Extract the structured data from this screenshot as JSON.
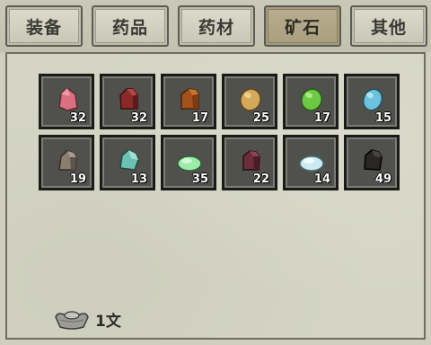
{
  "tabs": [
    {
      "label": "装备",
      "active": false
    },
    {
      "label": "药品",
      "active": false
    },
    {
      "label": "药材",
      "active": false
    },
    {
      "label": "矿石",
      "active": true
    },
    {
      "label": "其他",
      "active": false
    }
  ],
  "inventory": {
    "items": [
      {
        "name": "pink-ore",
        "icon": "ore-shard-icon",
        "color": "#d96f80",
        "count": "32"
      },
      {
        "name": "dark-red-ore",
        "icon": "ore-chunk-icon",
        "color": "#8a2a28",
        "count": "32"
      },
      {
        "name": "brown-ore",
        "icon": "ore-chunk-icon",
        "color": "#a2521a",
        "count": "17"
      },
      {
        "name": "gold-ore",
        "icon": "ore-egg-icon",
        "color": "#d6a85a",
        "count": "25"
      },
      {
        "name": "green-ore",
        "icon": "ore-egg-icon",
        "color": "#6cc944",
        "count": "17"
      },
      {
        "name": "cyan-ore",
        "icon": "ore-egg-icon",
        "color": "#6cc1dc",
        "count": "15"
      },
      {
        "name": "grey-ore",
        "icon": "ore-chunk-icon",
        "color": "#8a7e72",
        "count": "19"
      },
      {
        "name": "teal-ore",
        "icon": "ore-chunk-icon",
        "color": "#6cc2b0",
        "count": "13"
      },
      {
        "name": "light-green-ore",
        "icon": "ore-flat-icon",
        "color": "#9eeaa8",
        "count": "35"
      },
      {
        "name": "maroon-ore",
        "icon": "ore-chunk-icon",
        "color": "#6c2e3c",
        "count": "22"
      },
      {
        "name": "pale-blue-ore",
        "icon": "ore-flat-icon",
        "color": "#c9ecf2",
        "count": "14"
      },
      {
        "name": "black-ore",
        "icon": "ore-chunk-icon",
        "color": "#2a2626",
        "count": "49"
      }
    ]
  },
  "money": {
    "icon": "silver-ingot-icon",
    "text": "1文"
  }
}
